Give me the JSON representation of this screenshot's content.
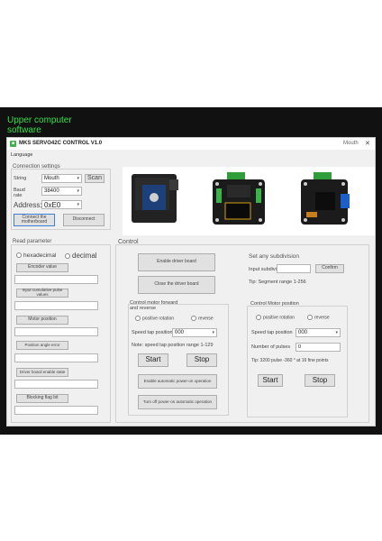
{
  "banner": {
    "line1": "Upper computer",
    "line2": "software"
  },
  "window": {
    "title": "MKS SERVO42C CONTROL V1.0",
    "close": "✕",
    "min": "—",
    "mouth_label": "Mouth"
  },
  "menu": {
    "language": "Language"
  },
  "connection": {
    "header": "Connection settings",
    "string_label": "String",
    "string_value": "Mouth",
    "scan": "Scan",
    "baud_label": "Baud rate",
    "baud_value": "38400",
    "address_label": "Address:",
    "address_value": "0xE0",
    "connect": "Connect the motherboard",
    "disconnect": "Disconnect"
  },
  "read": {
    "header": "Read parameter",
    "hex": "hexadecimal",
    "dec": "decimal",
    "encoder": "Encoder value",
    "pulses": "Input cumulative pulse values",
    "position": "Motor position",
    "angle": "Position angle error",
    "enable_state": "Driver board enable state",
    "blocking": "Blocking flag bit"
  },
  "control": {
    "header": "Control",
    "enable": "Enable driver board",
    "close": "Close the driver board",
    "forward_header": "Control motor forward and reverse",
    "positive": "positive rotation",
    "reverse": "reverse",
    "speed_label": "Speed tap position",
    "speed_value": "000",
    "note": "Note: speed tap position range 1-129",
    "start": "Start",
    "stop": "Stop",
    "auto_on": "Enable automatic power-on operation",
    "auto_off": "Turn off power-on automatic operation"
  },
  "subdivision": {
    "header": "Set any subdivision",
    "input_label": "Input subdivision",
    "confirm": "Confirm",
    "tip": "Tip: Segment range 1-256"
  },
  "motor_position": {
    "header": "Control Motor position",
    "positive": "positive rotation",
    "reverse": "reverse",
    "speed_label": "Speed tap position",
    "speed_value": "000",
    "pulses_label": "Number of pulses",
    "pulses_value": "0",
    "tip": "Tip: 3200 pulse -360 ° at 16 fine points",
    "start": "Start",
    "stop": "Stop"
  },
  "colors": {
    "banner_green": "#2ee046",
    "board_green": "#2f9e3a"
  }
}
